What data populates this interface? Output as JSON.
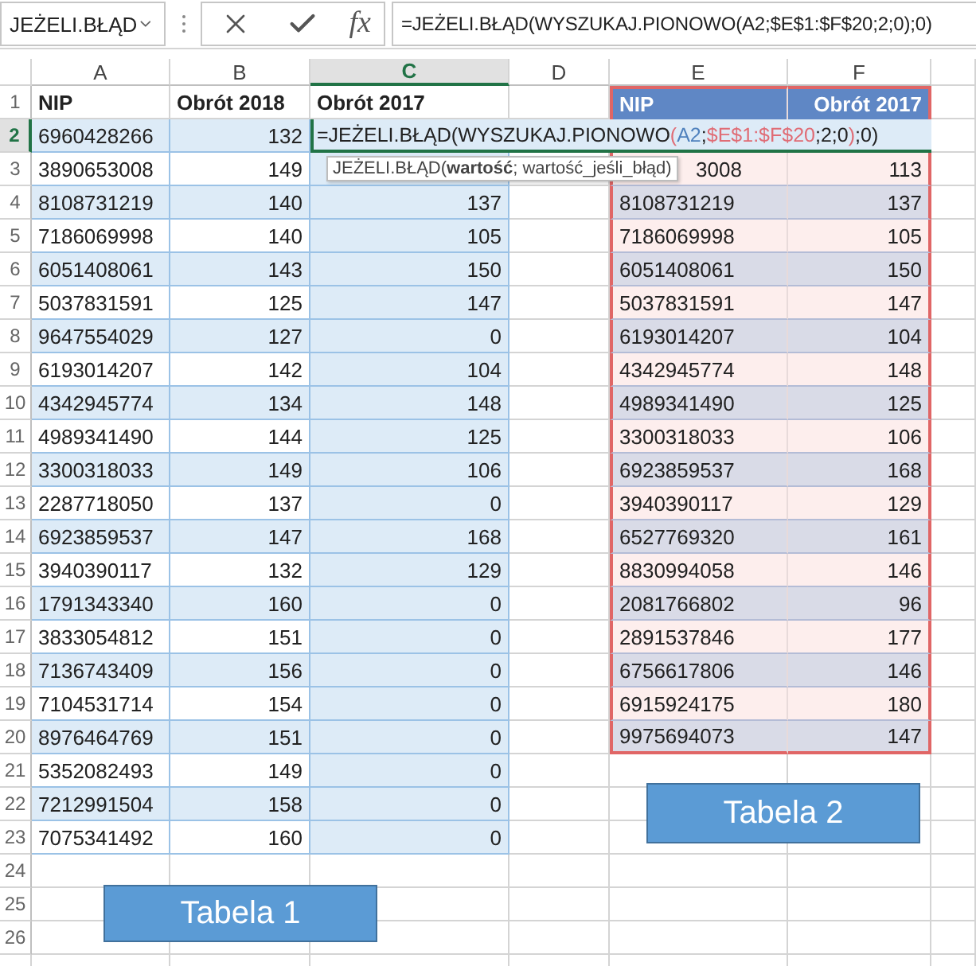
{
  "name_box": {
    "value": "JEŻELI.BŁĄD"
  },
  "formula_buttons": {
    "function": "fx"
  },
  "formula_bar": {
    "value": "=JEŻELI.BŁĄD(WYSZUKAJ.PIONOWO(A2;$E$1:$F$20;2;0);0)"
  },
  "columns": [
    {
      "label": "A",
      "selected": false
    },
    {
      "label": "B",
      "selected": false
    },
    {
      "label": "C",
      "selected": true
    },
    {
      "label": "D",
      "selected": false
    },
    {
      "label": "E",
      "selected": false
    },
    {
      "label": "F",
      "selected": false
    }
  ],
  "rows": [
    {
      "number": "1",
      "selected": false,
      "cells": {
        "A": "NIP",
        "B": "Obrót 2018",
        "C": "Obrót 2017",
        "E": "NIP",
        "F": "Obrót 2017"
      }
    },
    {
      "number": "2",
      "selected": true,
      "cells": {
        "A": "6960428266",
        "B": "132"
      },
      "editor": [
        {
          "text": "=JEŻELI.BŁĄD(WYSZUKAJ.PIONOWO"
        },
        {
          "text": "(",
          "color": "#e06c75"
        },
        {
          "text": "A2",
          "color": "#4f81bd"
        },
        {
          "text": ";"
        },
        {
          "text": "$E$1:$F$20",
          "color": "#e06c75"
        },
        {
          "text": ";2;0"
        },
        {
          "text": ")",
          "color": "#e06c75"
        },
        {
          "text": ";0)"
        }
      ]
    },
    {
      "number": "3",
      "selected": false,
      "cells": {
        "A": "3890653008",
        "B": "149",
        "E": "3008",
        "F": "113"
      },
      "tooltip": "JEŻELI.BŁĄD(**wartość**; wartość_jeśli_błąd)"
    },
    {
      "number": "4",
      "selected": false,
      "cells": {
        "A": "8108731219",
        "B": "140",
        "C": "137",
        "E": "8108731219",
        "F": "137"
      }
    },
    {
      "number": "5",
      "selected": false,
      "cells": {
        "A": "7186069998",
        "B": "140",
        "C": "105",
        "E": "7186069998",
        "F": "105"
      }
    },
    {
      "number": "6",
      "selected": false,
      "cells": {
        "A": "6051408061",
        "B": "143",
        "C": "150",
        "E": "6051408061",
        "F": "150"
      }
    },
    {
      "number": "7",
      "selected": false,
      "cells": {
        "A": "5037831591",
        "B": "125",
        "C": "147",
        "E": "5037831591",
        "F": "147"
      }
    },
    {
      "number": "8",
      "selected": false,
      "cells": {
        "A": "9647554029",
        "B": "127",
        "C": "0",
        "E": "6193014207",
        "F": "104"
      }
    },
    {
      "number": "9",
      "selected": false,
      "cells": {
        "A": "6193014207",
        "B": "142",
        "C": "104",
        "E": "4342945774",
        "F": "148"
      }
    },
    {
      "number": "10",
      "selected": false,
      "cells": {
        "A": "4342945774",
        "B": "134",
        "C": "148",
        "E": "4989341490",
        "F": "125"
      }
    },
    {
      "number": "11",
      "selected": false,
      "cells": {
        "A": "4989341490",
        "B": "144",
        "C": "125",
        "E": "3300318033",
        "F": "106"
      }
    },
    {
      "number": "12",
      "selected": false,
      "cells": {
        "A": "3300318033",
        "B": "149",
        "C": "106",
        "E": "6923859537",
        "F": "168"
      }
    },
    {
      "number": "13",
      "selected": false,
      "cells": {
        "A": "2287718050",
        "B": "137",
        "C": "0",
        "E": "3940390117",
        "F": "129"
      }
    },
    {
      "number": "14",
      "selected": false,
      "cells": {
        "A": "6923859537",
        "B": "147",
        "C": "168",
        "E": "6527769320",
        "F": "161"
      }
    },
    {
      "number": "15",
      "selected": false,
      "cells": {
        "A": "3940390117",
        "B": "132",
        "C": "129",
        "E": "8830994058",
        "F": "146"
      }
    },
    {
      "number": "16",
      "selected": false,
      "cells": {
        "A": "1791343340",
        "B": "160",
        "C": "0",
        "E": "2081766802",
        "F": "96"
      }
    },
    {
      "number": "17",
      "selected": false,
      "cells": {
        "A": "3833054812",
        "B": "151",
        "C": "0",
        "E": "2891537846",
        "F": "177"
      }
    },
    {
      "number": "18",
      "selected": false,
      "cells": {
        "A": "7136743409",
        "B": "156",
        "C": "0",
        "E": "6756617806",
        "F": "146"
      }
    },
    {
      "number": "19",
      "selected": false,
      "cells": {
        "A": "7104531714",
        "B": "154",
        "C": "0",
        "E": "6915924175",
        "F": "180"
      }
    },
    {
      "number": "20",
      "selected": false,
      "cells": {
        "A": "8976464769",
        "B": "151",
        "C": "0",
        "E": "9975694073",
        "F": "147"
      }
    },
    {
      "number": "21",
      "selected": false,
      "cells": {
        "A": "5352082493",
        "B": "149",
        "C": "0"
      }
    },
    {
      "number": "22",
      "selected": false,
      "cells": {
        "A": "7212991504",
        "B": "158",
        "C": "0"
      }
    },
    {
      "number": "23",
      "selected": false,
      "cells": {
        "A": "7075341492",
        "B": "160",
        "C": "0"
      }
    },
    {
      "number": "24",
      "selected": false
    },
    {
      "number": "25",
      "selected": false
    },
    {
      "number": "26",
      "selected": false
    }
  ],
  "shapes": [
    {
      "label": "Tabela 1"
    },
    {
      "label": "Tabela 2"
    }
  ]
}
